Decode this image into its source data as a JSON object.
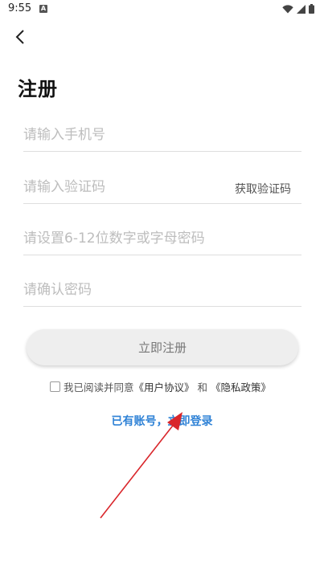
{
  "status_bar": {
    "time": "9:55",
    "notification_letter": "A",
    "icons": [
      "wifi-icon",
      "signal-icon",
      "battery-icon"
    ]
  },
  "header": {
    "back_icon": "chevron-left-icon"
  },
  "page": {
    "title": "注册"
  },
  "form": {
    "phone_placeholder": "请输入手机号",
    "code_placeholder": "请输入验证码",
    "get_code_label": "获取验证码",
    "password_placeholder": "请设置6-12位数字或字母密码",
    "confirm_placeholder": "请确认密码",
    "register_label": "立即注册"
  },
  "agreement": {
    "prefix": "我已阅读并同意",
    "user_agreement": "《用户协议》",
    "conjunction": "和",
    "privacy_policy": "《隐私政策》",
    "checked": false
  },
  "login": {
    "link_text": "已有账号，立即登录"
  },
  "colors": {
    "accent": "#2f82d6",
    "annotation_arrow": "#d9262b",
    "button_bg": "#eeeeee",
    "placeholder": "#bdbdbd"
  }
}
